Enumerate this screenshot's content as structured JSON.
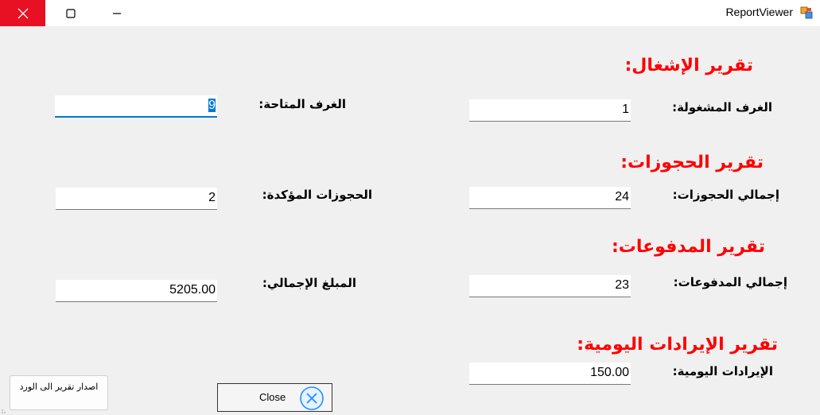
{
  "window": {
    "title": "ReportViewer",
    "icons": {
      "close": "close-icon",
      "maximize": "maximize-icon",
      "minimize": "minimize-icon",
      "app": "app-icon"
    }
  },
  "sections": {
    "occupancy": {
      "heading": "تقرير الإشغال:",
      "occupied_label": "الغرف المشغولة:",
      "occupied_value": "1",
      "available_label": "الغرف المتاحة:",
      "available_value": "9"
    },
    "bookings": {
      "heading": "تقرير الحجوزات:",
      "total_label": "إجمالي الحجوزات:",
      "total_value": "24",
      "confirmed_label": "الحجوزات المؤكدة:",
      "confirmed_value": "2"
    },
    "payments": {
      "heading": "تقرير المدفوعات:",
      "total_label": "إجمالي المدفوعات:",
      "total_value": "23",
      "amount_label": "المبلغ الإجمالي:",
      "amount_value": "5205.00"
    },
    "daily_revenue": {
      "heading": "تقرير الإيرادات اليومية:",
      "revenue_label": "الإيرادات اليومية:",
      "revenue_value": "150.00"
    }
  },
  "buttons": {
    "export_label": "اصدار تقرير الى الورد",
    "close_label": "Close"
  },
  "colors": {
    "heading": "#ff0000",
    "close_hover": "#e81123",
    "focus": "#0078d7",
    "close_icon": "#1e90ff"
  }
}
